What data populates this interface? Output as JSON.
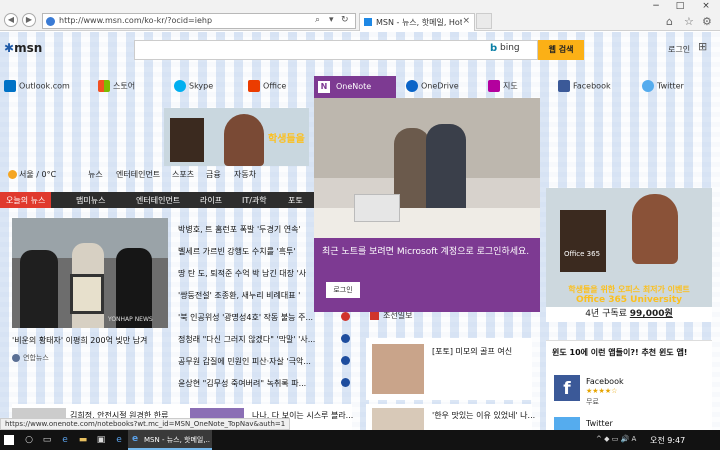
{
  "browser": {
    "address_url": "http://www.msn.com/ko-kr/?ocid=iehp",
    "tab_label": "MSN - 뉴스, 핫메일, Hotm...",
    "window_buttons": [
      "−",
      "□",
      "×"
    ]
  },
  "msn": {
    "logo": "msn",
    "search_brand": "bing",
    "search_button": "웹 검색",
    "login_link": "로그인"
  },
  "services": [
    {
      "label": "Outlook.com",
      "color": "#0072c6"
    },
    {
      "label": "스토어",
      "color": "#e81123"
    },
    {
      "label": "Skype",
      "color": "#00aff0"
    },
    {
      "label": "Office",
      "color": "#eb3c00"
    },
    {
      "label": "OneNote",
      "color": "#7d3a92"
    },
    {
      "label": "OneDrive",
      "color": "#0a64c8"
    },
    {
      "label": "지도",
      "color": "#b4009e"
    },
    {
      "label": "Facebook",
      "color": "#3b5998"
    },
    {
      "label": "Twitter",
      "color": "#55acee"
    }
  ],
  "promo_left": {
    "text": "학생들을"
  },
  "weather": {
    "text": "서울 / 0°C"
  },
  "categories": [
    "뉴스",
    "엔터테인먼트",
    "스포츠",
    "금융",
    "자동차"
  ],
  "news_tabs": [
    "오늘의 뉴스",
    "맵미뉴스",
    "엔터테인먼트",
    "라이프",
    "IT/과학",
    "포토"
  ],
  "main_story": {
    "watermark": "YONHAP NEWS",
    "caption": "'비운의 황태자' 이평희 200억 빚만 남겨",
    "source": "연합뉴스"
  },
  "headlines": [
    {
      "text": "박병호, 트 홈런포 폭발 '두경기 연속'"
    },
    {
      "text": "벨세르 가르빈 강행도 수치를 '흑투'"
    },
    {
      "text": "땅 탄 도, 퇴적준 수억 박 남긴 대장 '사"
    },
    {
      "text": "'쌍둥전설' 조종환, 새누리 비례대표 '"
    },
    {
      "text": "'북 인공위성 '광명성4호' 작동 불능 주..."
    },
    {
      "text": "정청래 \"다신 그러지 않겠다\" '막말' '사..."
    },
    {
      "text": "공무원 갑질에 민원인 피산·자살 '극악..."
    },
    {
      "text": "윤상현 \"김무성 죽여버려\" 녹취록 파..."
    }
  ],
  "onenote": {
    "tab_label": "OneNote",
    "message": "최근 노트를 보려면 Microsoft 계정으로 로그인하세요.",
    "login_button": "로그인"
  },
  "right_promo": {
    "box_label": "Office 365",
    "line1": "학생들을 위한 오피스 최저가 이벤트",
    "line2": "Office 365 University",
    "line3_prefix": "4년 구독료 ",
    "line3_price": "99,000원"
  },
  "apps_box": {
    "title": "윈도 10에 이런 앱들이?! 추천 윈도 앱!",
    "facebook_name": "Facebook",
    "facebook_stars": "★★★★☆",
    "facebook_price": "무료",
    "twitter_name": "Twitter"
  },
  "middle": {
    "chosun_source": "조선일보",
    "card2_text": "[포토] 미모의 골프 여신",
    "card3_text": "'한우 맛있는 이유 있었네'  나..."
  },
  "bottom_left": {
    "text1": "김희정, 안전시절 원경한 한류",
    "text2": "나나, 다 보이는 시스루 블라..."
  },
  "status_url": "https://www.onenote.com/notebooks?wt.mc_id=MSN_OneNote_TopNav&auth=1",
  "taskbar": {
    "app_label": "MSN - 뉴스, 핫메일,...",
    "tray": "^ ◆ ▭ 🔊 A",
    "time": "오전 9:47"
  }
}
